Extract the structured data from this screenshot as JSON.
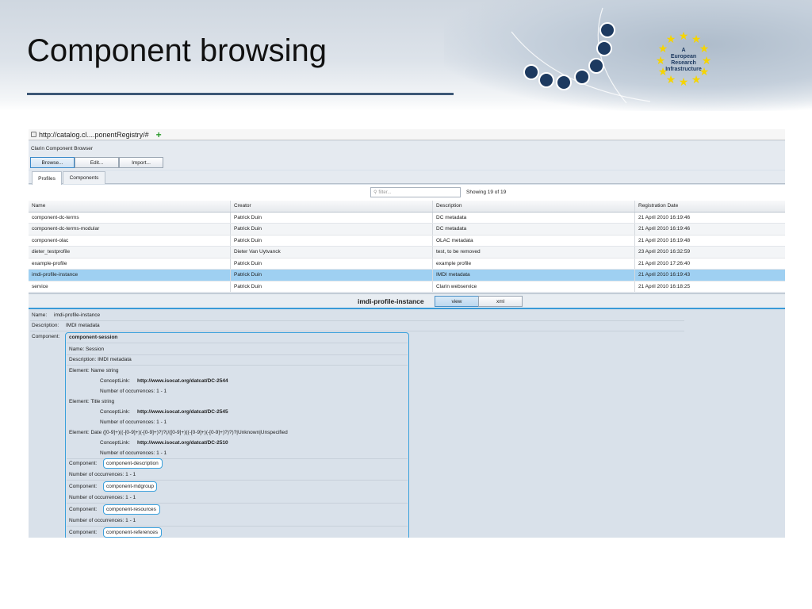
{
  "slide": {
    "title": "Component browsing",
    "logo_text": [
      "A",
      "European",
      "Research",
      "Infrastructure"
    ]
  },
  "browser": {
    "url": "http://catalog.cl....ponentRegistry/#",
    "add_tab_glyph": "+",
    "app_title": "Clarin Component Browser",
    "toolbar": {
      "browse": "Browse...",
      "edit": "Edit...",
      "import": "Import..."
    },
    "tabs": {
      "profiles": "Profiles",
      "components": "Components"
    },
    "filter_placeholder": "filter...",
    "showing": "Showing 19 of 19"
  },
  "table": {
    "columns": [
      "Name",
      "Creator",
      "Description",
      "Registration Date"
    ],
    "rows": [
      [
        "component-dc-terms",
        "Patrick Duin",
        "DC metadata",
        "21 April 2010 16:19:46"
      ],
      [
        "component-dc-terms-modular",
        "Patrick Duin",
        "DC metadata",
        "21 April 2010 16:19:46"
      ],
      [
        "component-olac",
        "Patrick Duin",
        "OLAC metadata",
        "21 April 2010 16:19:48"
      ],
      [
        "dieter_testprofile",
        "Dieter Van Uytvanck",
        "test, to be removed",
        "23 April 2010 16:32:59"
      ],
      [
        "example-profile",
        "Patrick Duin",
        "example profile",
        "21 April 2010 17:26:40"
      ],
      [
        "imdi-profile-instance",
        "Patrick Duin",
        "IMDI metadata",
        "21 April 2010 16:19:43"
      ],
      [
        "service",
        "Patrick Duin",
        "Clarin webservice",
        "21 April 2010 16:18:25"
      ]
    ],
    "selected_index": 5
  },
  "view": {
    "selected_name": "imdi-profile-instance",
    "view_btn": "view",
    "xml_btn": "xml"
  },
  "detail": {
    "name_label": "Name:",
    "name_value": "imdi-profile-instance",
    "desc_label": "Description:",
    "desc_value": "IMDI metadata",
    "component_label": "Component:",
    "component_title": "component-session",
    "inner_name": "Name:   Session",
    "inner_desc": "Description:   IMDI metadata",
    "elements": [
      {
        "head": "Element:   Name   string",
        "concept": "ConceptLink:",
        "concept_url": "http://www.isocat.org/datcat/DC-2544",
        "occ": "Number of occurrences:   1 - 1"
      },
      {
        "head": "Element:   Title   string",
        "concept": "ConceptLink:",
        "concept_url": "http://www.isocat.org/datcat/DC-2545",
        "occ": "Number of occurrences:   1 - 1"
      },
      {
        "head": "Element:   Date   ([0-9]+)((-[0-9]+)(-[0-9]+)?)?(/([0-9]+)((-[0-9]+)(-[0-9]+)?)?)?|Unknown|Unspecified",
        "concept": "ConceptLink:",
        "concept_url": "http://www.isocat.org/datcat/DC-2510",
        "occ": "Number of occurrences:   1 - 1"
      }
    ],
    "subcomponents": [
      {
        "label": "Component:",
        "name": "component-description",
        "occ": "Number of occurrences:   1 - 1"
      },
      {
        "label": "Component:",
        "name": "component-mdgroup",
        "occ": "Number of occurrences:   1 - 1"
      },
      {
        "label": "Component:",
        "name": "component-resources",
        "occ": "Number of occurrences:   1 - 1"
      },
      {
        "label": "Component:",
        "name": "component-references",
        "occ": ""
      }
    ]
  },
  "colors": {
    "accent": "#3aa0dc",
    "selected_row": "#9fd0f2",
    "title_rule": "#3d5876",
    "logo_star": "#f5d400"
  }
}
